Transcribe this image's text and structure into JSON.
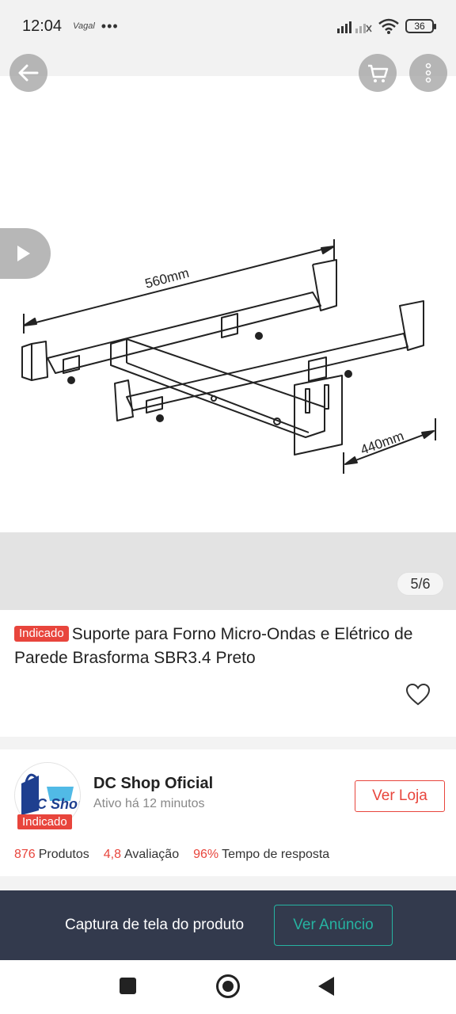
{
  "status_bar": {
    "time": "12:04",
    "notification": "Vagal",
    "more": "•••",
    "battery": "36"
  },
  "gallery": {
    "counter": "5/6",
    "dimension_width": "560mm",
    "dimension_depth": "440mm"
  },
  "product": {
    "badge": "Indicado",
    "title": "Suporte para Forno Micro-Ondas e Elétrico de Parede Brasforma SBR3.4 Preto"
  },
  "shop": {
    "logo_text": "DC Shop",
    "badge": "Indicado",
    "name": "DC Shop Oficial",
    "active": "Ativo há 12 minutos",
    "visit_label": "Ver Loja",
    "stats": [
      {
        "value": "876",
        "label": "Produtos"
      },
      {
        "value": "4,8",
        "label": "Avaliação"
      },
      {
        "value": "96%",
        "label": "Tempo de resposta"
      }
    ]
  },
  "capture_banner": {
    "text": "Captura de tela do produto",
    "button_label": "Ver Anúncio"
  },
  "colors": {
    "accent": "#e8453c",
    "banner_bg": "#333a4d",
    "teal": "#26b3a1"
  }
}
